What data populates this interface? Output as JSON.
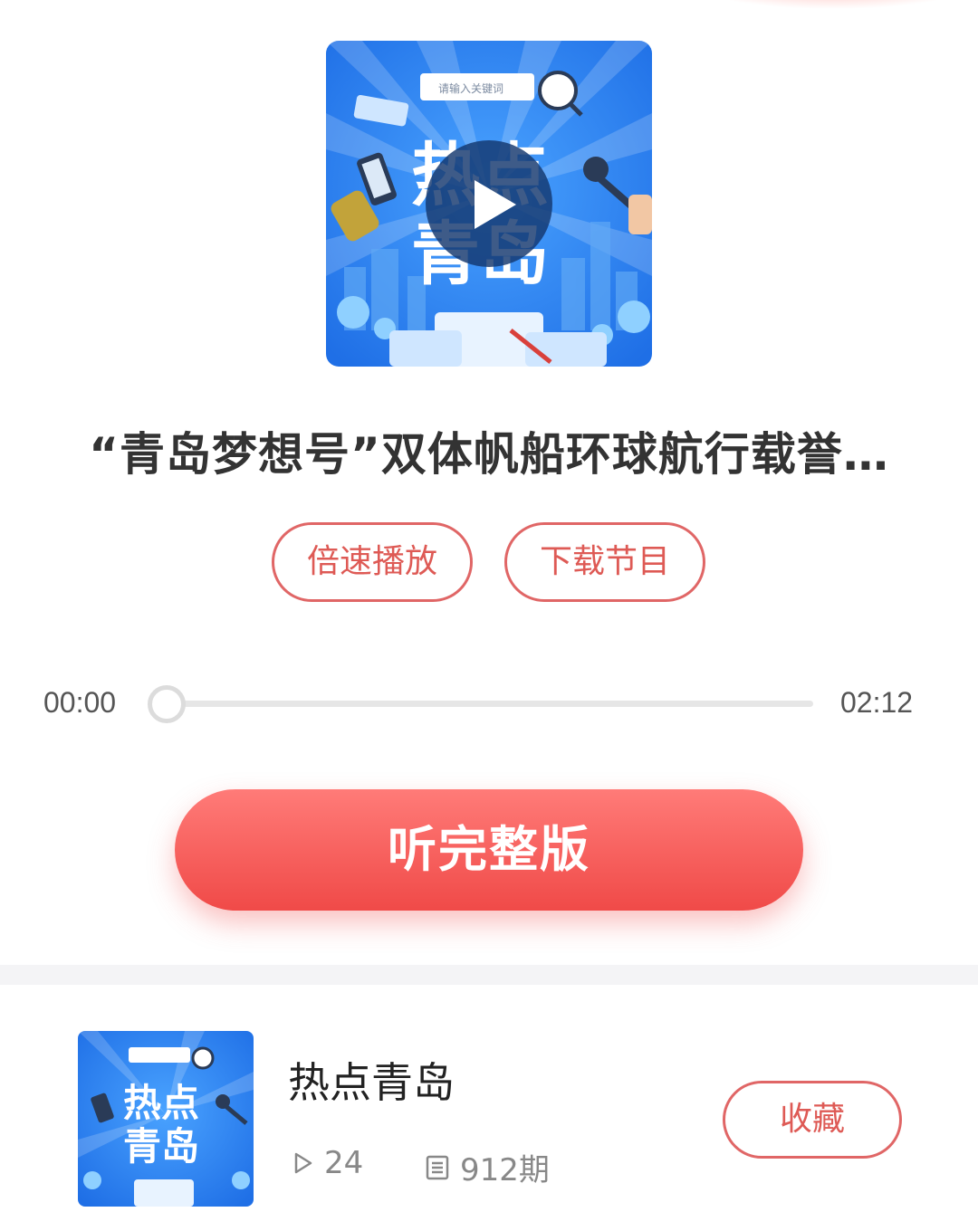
{
  "cover": {
    "search_placeholder": "请输入关键词",
    "art_text_line1": "热点",
    "art_text_line2": "青岛"
  },
  "player": {
    "episode_title": "“青岛梦想号”双体帆船环球航行载誉…",
    "speed_label": "倍速播放",
    "download_label": "下载节目",
    "current_time": "00:00",
    "total_time": "02:12",
    "progress": 0.0,
    "full_version_label": "听完整版"
  },
  "album": {
    "name": "热点青岛",
    "plays": "24",
    "episodes": "912期",
    "collect_label": "收藏"
  },
  "colors": {
    "accent": "#e06666",
    "cover_blue": "#2f7ff0",
    "button_gradient_top": "#ff7b78",
    "button_gradient_bottom": "#f04a48"
  }
}
